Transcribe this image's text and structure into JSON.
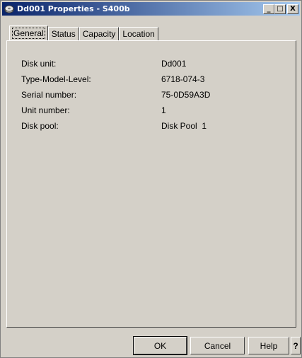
{
  "window": {
    "title": "Dd001 Properties - S400b",
    "icon": "disk-icon",
    "minimize_glyph": "_",
    "maximize_glyph": "□",
    "close_glyph": "X"
  },
  "tabs": [
    {
      "label": "General",
      "active": true
    },
    {
      "label": "Status",
      "active": false
    },
    {
      "label": "Capacity",
      "active": false
    },
    {
      "label": "Location",
      "active": false
    }
  ],
  "properties": [
    {
      "label": "Disk unit:",
      "value": "Dd001"
    },
    {
      "label": "Type-Model-Level:",
      "value": "6718-074-3"
    },
    {
      "label": "Serial number:",
      "value": "75-0D59A3D"
    },
    {
      "label": "Unit number:",
      "value": "1"
    },
    {
      "label": "Disk pool:",
      "value": "Disk Pool  1"
    }
  ],
  "buttons": {
    "ok": "OK",
    "cancel": "Cancel",
    "help": "Help",
    "whats_this": "?"
  }
}
